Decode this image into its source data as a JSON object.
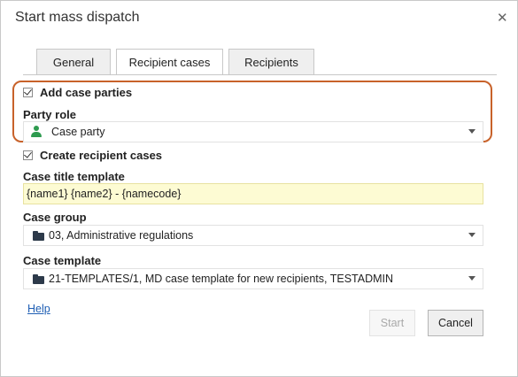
{
  "dialog": {
    "title": "Start mass dispatch",
    "close_symbol": "✕"
  },
  "tabs": [
    {
      "label": "General",
      "active": false
    },
    {
      "label": "Recipient cases",
      "active": true
    },
    {
      "label": "Recipients",
      "active": false
    }
  ],
  "add_case_parties": {
    "label": "Add case parties",
    "checked": true,
    "party_role_label": "Party role",
    "party_role_value": "Case party",
    "party_role_icon": "person-icon"
  },
  "create_recipient_cases": {
    "label": "Create recipient cases",
    "checked": true
  },
  "case_title_template": {
    "label": "Case title template",
    "value": "{name1} {name2} - {namecode}"
  },
  "case_group": {
    "label": "Case group",
    "value": "03, Administrative regulations",
    "icon": "folder-icon"
  },
  "case_template": {
    "label": "Case template",
    "value": "21-TEMPLATES/1, MD case template for new recipients, TESTADMIN",
    "icon": "folder-icon"
  },
  "footer": {
    "help_label": "Help",
    "start_label": "Start",
    "start_enabled": false,
    "cancel_label": "Cancel"
  },
  "colors": {
    "highlight_border": "#c8622a",
    "template_field_bg": "#fdfbd3",
    "person_icon": "#2e9b4f",
    "link": "#1f5fb4"
  }
}
